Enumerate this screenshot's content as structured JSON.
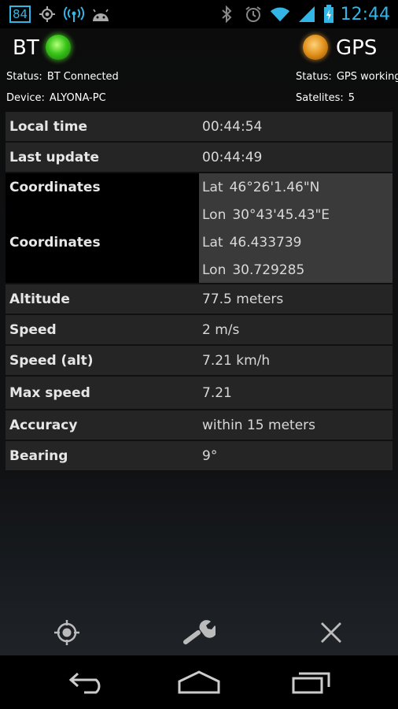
{
  "status_bar": {
    "notification_count": "84",
    "time": "12:44",
    "icons": [
      "gps-location-icon",
      "hotspot-icon",
      "android-icon",
      "bluetooth-icon",
      "alarm-icon",
      "wifi-icon",
      "signal-icon",
      "battery-charging-icon"
    ]
  },
  "header": {
    "bt_label": "BT",
    "gps_label": "GPS",
    "bt_led_color": "#39c51a",
    "gps_led_color": "#e0901a"
  },
  "bt_info": {
    "status_label": "Status:",
    "status_value": "BT Connected",
    "device_label": "Device:",
    "device_value": "ALYONA-PC"
  },
  "gps_info": {
    "status_label": "Status:",
    "status_value": "GPS working",
    "satellites_label": "Satelites:",
    "satellites_value": "5"
  },
  "table": {
    "local_time": {
      "label": "Local time",
      "value": "00:44:54"
    },
    "last_update": {
      "label": "Last update",
      "value": "00:44:49"
    },
    "coordinates_dms": {
      "label": "Coordinates",
      "lat_label": "Lat",
      "lat_value": "46°26'1.46\"N",
      "lon_label": "Lon",
      "lon_value": "30°43'45.43\"E"
    },
    "coordinates_dec": {
      "label": "Coordinates",
      "lat_label": "Lat",
      "lat_value": "46.433739",
      "lon_label": "Lon",
      "lon_value": "30.729285"
    },
    "altitude": {
      "label": "Altitude",
      "value": "77.5 meters"
    },
    "speed": {
      "label": "Speed",
      "value": "2 m/s"
    },
    "speed_alt": {
      "label": "Speed (alt)",
      "value": "7.21 km/h"
    },
    "max_speed": {
      "label": "Max speed",
      "value": "7.21"
    },
    "accuracy": {
      "label": "Accuracy",
      "value": "within 15  meters"
    },
    "bearing": {
      "label": "Bearing",
      "value": "9°"
    }
  },
  "toolbar": {
    "icons": [
      "locate-icon",
      "settings-wrench-icon",
      "close-icon"
    ]
  },
  "navbar": {
    "icons": [
      "back-icon",
      "home-icon",
      "recent-apps-icon"
    ]
  }
}
